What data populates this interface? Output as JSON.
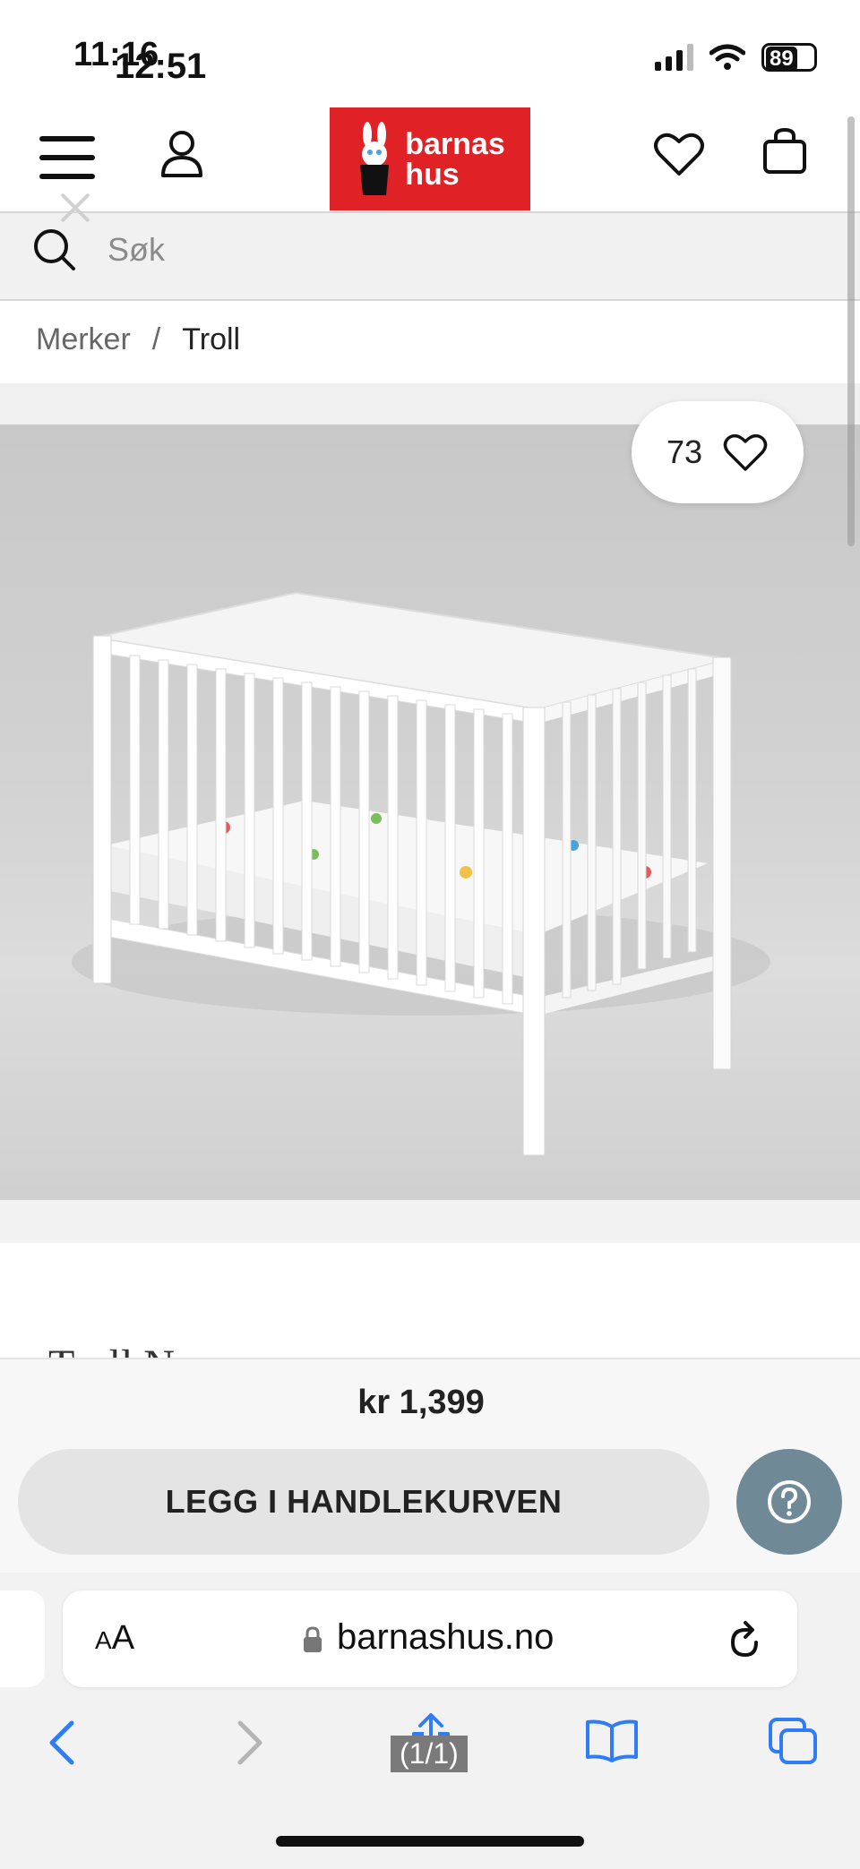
{
  "status_bar": {
    "time_overlap": "11:16",
    "time": "12:51",
    "battery": "89"
  },
  "header": {
    "logo_line1": "barnas",
    "logo_line2": "hus"
  },
  "search": {
    "placeholder": "Søk"
  },
  "breadcrumb": {
    "items": [
      "Merker",
      "Troll"
    ],
    "separator": "/"
  },
  "product": {
    "favorite_count": "73",
    "partial_title": "Troll N",
    "price": "kr 1,399",
    "add_to_cart_label": "LEGG I HANDLEKURVEN"
  },
  "browser": {
    "text_size_label_small": "A",
    "text_size_label_large": "A",
    "url": "barnashus.no",
    "page_counter": "(1/1)"
  },
  "colors": {
    "logo_red": "#e02227",
    "help_button": "#6f8a96",
    "safari_blue": "#2f7cf6"
  }
}
